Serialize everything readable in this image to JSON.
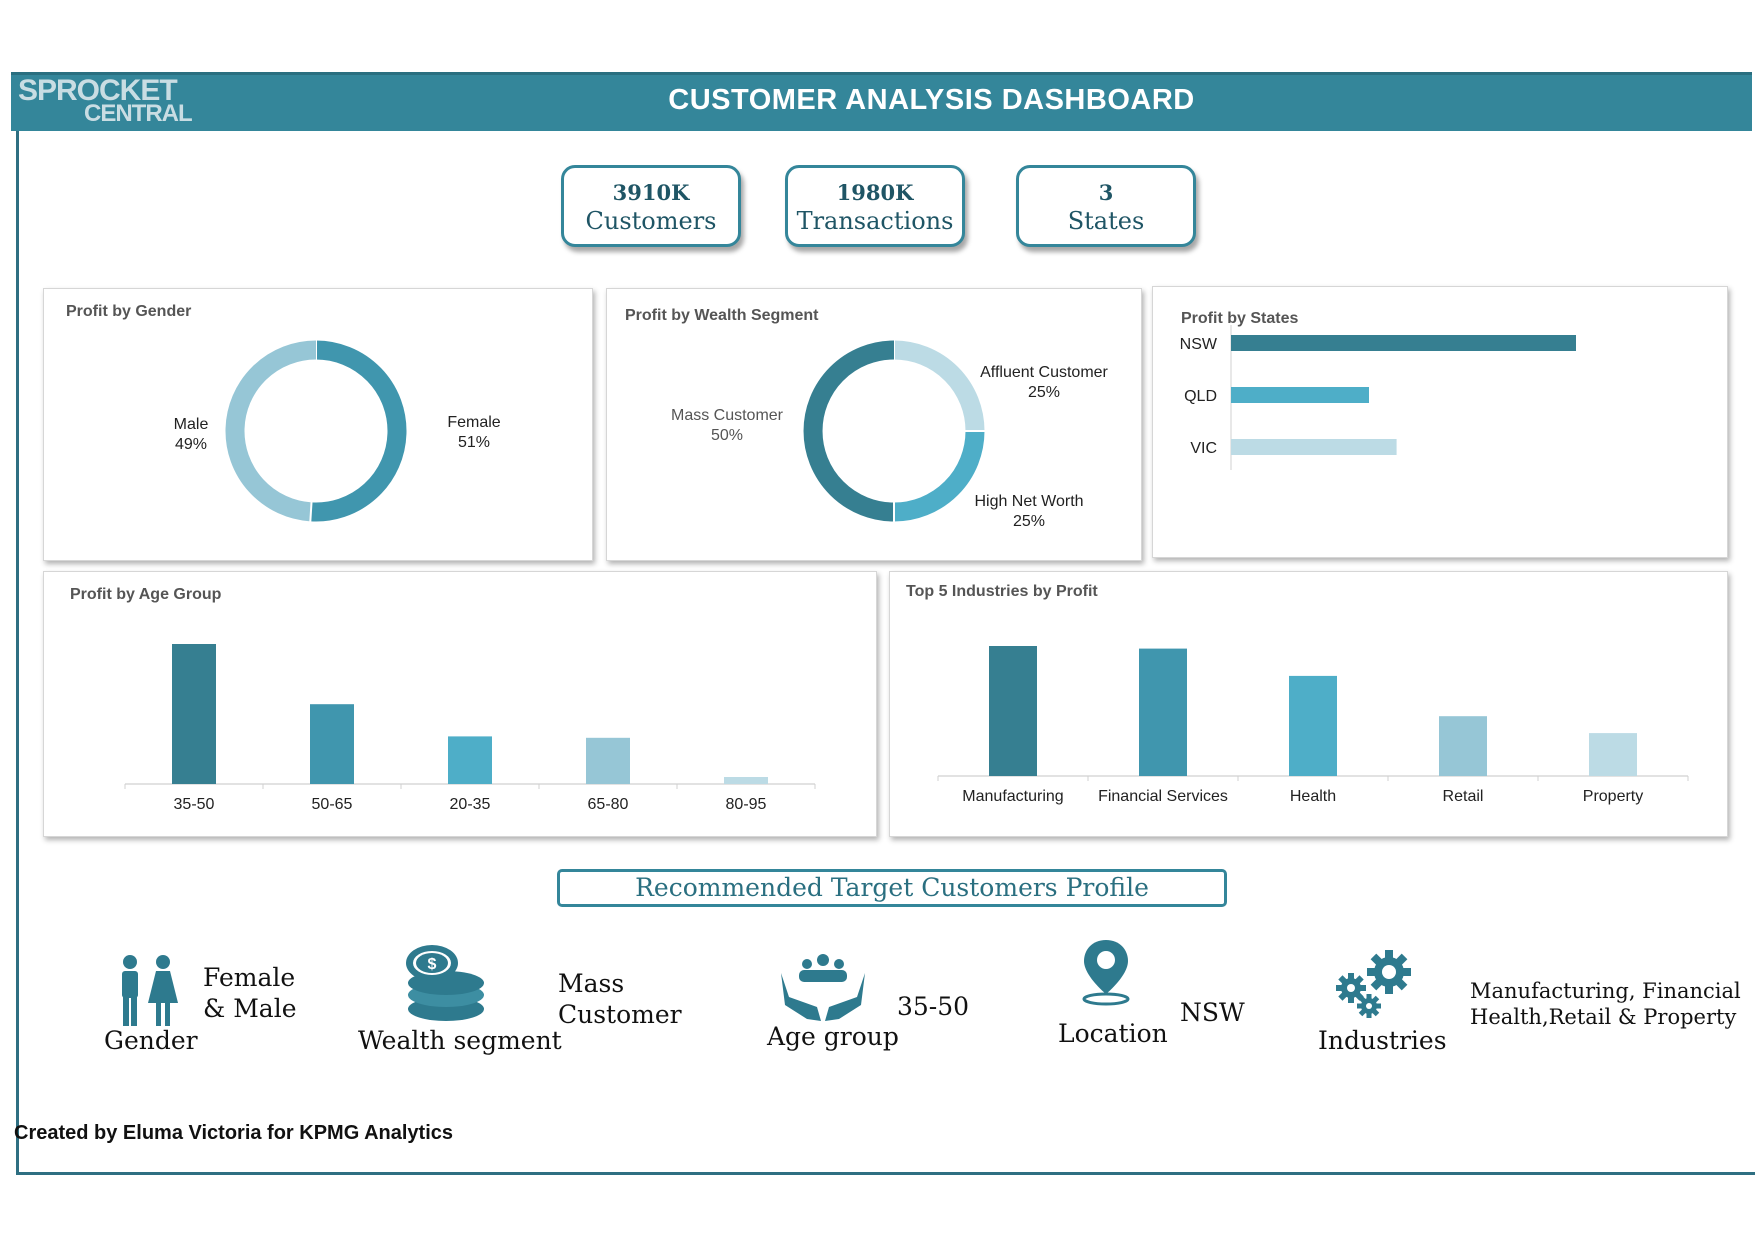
{
  "header": {
    "logo_line1": "SPROCKET",
    "logo_line2": "CENTRAL",
    "title": "CUSTOMER ANALYSIS DASHBOARD"
  },
  "kpis": [
    {
      "value": "3910K",
      "label": "Customers"
    },
    {
      "value": "1980K",
      "label": "Transactions"
    },
    {
      "value": "3",
      "label": "States"
    }
  ],
  "colors": {
    "brand": "#34869a",
    "dark": "#2e6f82",
    "teal1": "#367f91",
    "teal2": "#4096ae",
    "teal3": "#4eaec8",
    "teal4": "#96c6d6",
    "teal5": "#bcdbe5"
  },
  "chart_data": [
    {
      "type": "pie",
      "title": "Profit by Gender",
      "slices": [
        {
          "label": "Female",
          "pct_label": "51%",
          "value": 51
        },
        {
          "label": "Male",
          "pct_label": "49%",
          "value": 49
        }
      ]
    },
    {
      "type": "pie",
      "title": "Profit by Wealth Segment",
      "slices": [
        {
          "label": "Affluent Customer",
          "pct_label": "25%",
          "value": 25
        },
        {
          "label": "High Net Worth",
          "pct_label": "25%",
          "value": 25
        },
        {
          "label": "Mass Customer",
          "pct_label": "50%",
          "value": 50
        }
      ]
    },
    {
      "type": "bar",
      "title": "Profit by States",
      "orientation": "horizontal",
      "categories": [
        "NSW",
        "QLD",
        "VIC"
      ],
      "values": [
        100,
        40,
        48
      ]
    },
    {
      "type": "bar",
      "title": "Profit by Age Group",
      "categories": [
        "35-50",
        "50-65",
        "20-35",
        "65-80",
        "80-95"
      ],
      "values": [
        100,
        57,
        34,
        33,
        5
      ]
    },
    {
      "type": "bar",
      "title": "Top 5 Industries by Profit",
      "categories": [
        "Manufacturing",
        "Financial Services",
        "Health",
        "Retail",
        "Property"
      ],
      "values": [
        100,
        98,
        77,
        46,
        33
      ]
    }
  ],
  "recommendation": {
    "title": "Recommended Target Customers Profile",
    "items": [
      {
        "icon": "people-icon",
        "caption": "Gender",
        "value_line1": "Female",
        "value_line2": "& Male"
      },
      {
        "icon": "coins-icon",
        "caption": "Wealth segment",
        "value_line1": "Mass",
        "value_line2": "Customer"
      },
      {
        "icon": "group-hands-icon",
        "caption": "Age group",
        "value_line1": "35-50",
        "value_line2": ""
      },
      {
        "icon": "location-pin-icon",
        "caption": "Location",
        "value_line1": "NSW",
        "value_line2": ""
      },
      {
        "icon": "gears-icon",
        "caption": "Industries",
        "value_line1": "Manufacturing, Financial",
        "value_line2": "Health,Retail & Property"
      }
    ]
  },
  "footer": "Created by Eluma Victoria for KPMG Analytics"
}
